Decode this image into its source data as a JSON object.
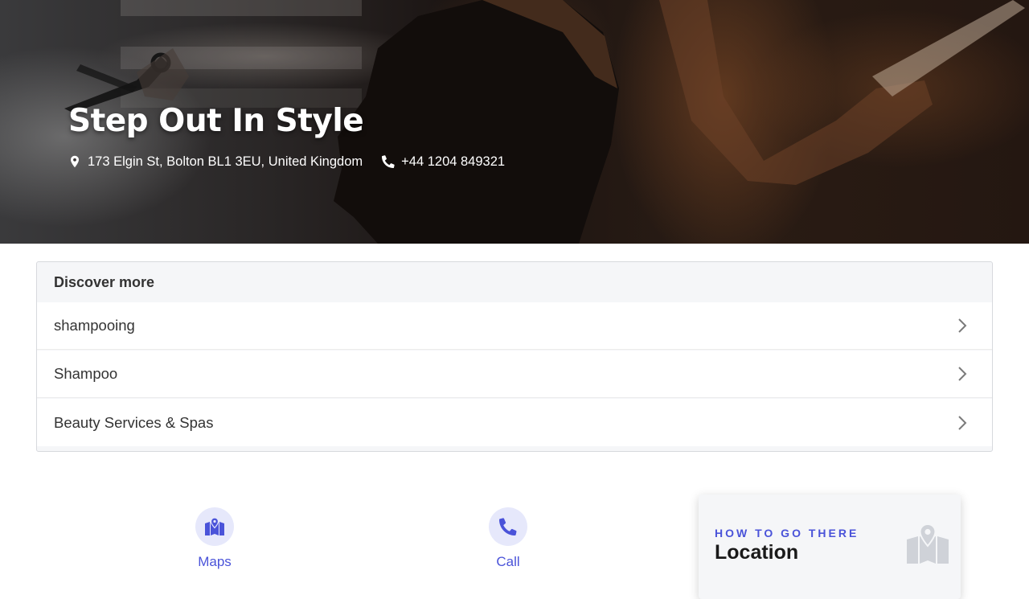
{
  "hero": {
    "title": "Step Out In Style",
    "address": "173 Elgin St, Bolton BL1 3EU, United Kingdom",
    "phone": "+44 1204 849321",
    "address_icon": "map-pin-icon",
    "phone_icon": "phone-icon"
  },
  "discover": {
    "heading": "Discover more",
    "items": [
      {
        "label": "shampooing"
      },
      {
        "label": "Shampoo"
      },
      {
        "label": "Beauty Services & Spas"
      }
    ],
    "item_icon": "chevron-right-icon"
  },
  "actions": [
    {
      "label": "Maps",
      "icon": "map-icon"
    },
    {
      "label": "Call",
      "icon": "phone-icon"
    }
  ],
  "location": {
    "kicker": "HOW TO GO THERE",
    "title": "Location",
    "icon": "map-marker-icon"
  },
  "colors": {
    "accent": "#4a53d9",
    "accent_soft": "#e6e8fb",
    "panel_bg": "#f5f6f8",
    "text": "#333333"
  }
}
